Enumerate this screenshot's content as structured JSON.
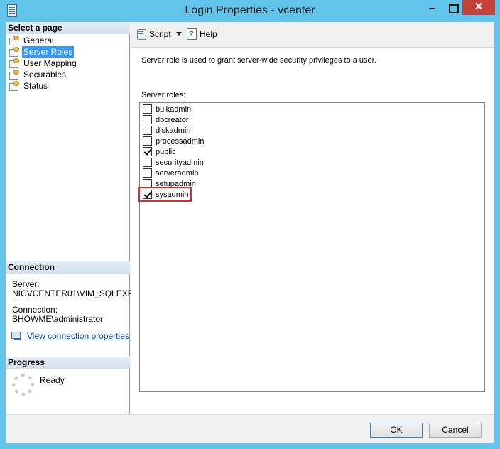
{
  "window": {
    "title": "Login Properties - vcenter",
    "close_glyph": "✕"
  },
  "sidebar": {
    "header": "Select a page",
    "items": [
      {
        "label": "General",
        "icon": "page-icon"
      },
      {
        "label": "Server Roles",
        "icon": "page-icon",
        "selected": true
      },
      {
        "label": "User Mapping",
        "icon": "page-icon"
      },
      {
        "label": "Securables",
        "icon": "page-icon"
      },
      {
        "label": "Status",
        "icon": "page-icon"
      }
    ]
  },
  "connection": {
    "header": "Connection",
    "server_label": "Server:",
    "server_value": "NICVCENTER01\\VIM_SQLEXP",
    "connection_label": "Connection:",
    "connection_value": "SHOWME\\administrator",
    "link_text": "View connection properties"
  },
  "progress": {
    "header": "Progress",
    "status": "Ready"
  },
  "toolbar": {
    "script_label": "Script",
    "help_label": "Help"
  },
  "main": {
    "description": "Server role is used to grant server-wide security privileges to a user.",
    "roles_label": "Server roles:",
    "roles": [
      {
        "name": "bulkadmin",
        "checked": false
      },
      {
        "name": "dbcreator",
        "checked": false
      },
      {
        "name": "diskadmin",
        "checked": false
      },
      {
        "name": "processadmin",
        "checked": false
      },
      {
        "name": "public",
        "checked": true
      },
      {
        "name": "securityadmin",
        "checked": false
      },
      {
        "name": "serveradmin",
        "checked": false
      },
      {
        "name": "setupadmin",
        "checked": false
      },
      {
        "name": "sysadmin",
        "checked": true,
        "highlighted": true
      }
    ]
  },
  "buttons": {
    "ok": "OK",
    "cancel": "Cancel"
  },
  "colors": {
    "titlebar": "#5fc3ea",
    "selection": "#3399ff",
    "highlight": "#e02b2b",
    "close": "#c7413b"
  }
}
